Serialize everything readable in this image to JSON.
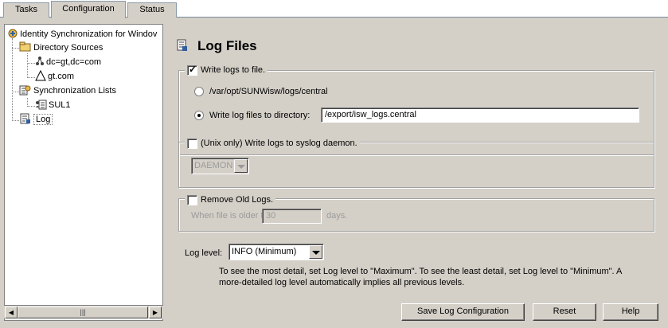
{
  "tabs": [
    {
      "label": "Tasks"
    },
    {
      "label": "Configuration"
    },
    {
      "label": "Status"
    }
  ],
  "tree": {
    "root": "Identity Synchronization for Windov",
    "directory_sources": "Directory Sources",
    "ds_child_1": "dc=gt,dc=com",
    "ds_child_2": "gt.com",
    "sync_lists": "Synchronization Lists",
    "sync_child_1": "SUL1",
    "log": "Log"
  },
  "page": {
    "title": "Log Files"
  },
  "write_to_file": {
    "checked": true,
    "label": "Write logs to file.",
    "option_default": "/var/opt/SUNWisw/logs/central",
    "option_custom_label": "Write log files to directory:",
    "directory_value": "/export/isw_logs.central"
  },
  "syslog": {
    "checked": false,
    "label": "(Unix only) Write logs to syslog daemon.",
    "facility_value": "DAEMON"
  },
  "remove_old": {
    "checked": false,
    "label": "Remove Old Logs.",
    "older_than_label": "When file is older than :",
    "days_value": "30",
    "days_unit": "days."
  },
  "log_level": {
    "label": "Log level:",
    "value": "INFO (Minimum)",
    "help_line_1": "To see the most detail, set Log level to \"Maximum\". To see the least detail, set Log level to \"Minimum\". A",
    "help_line_2": "more-detailed log level automatically implies all previous levels."
  },
  "buttons": {
    "save": "Save Log Configuration",
    "reset": "Reset",
    "help": "Help"
  },
  "scrollbar": {
    "thumb_glyph": "|||"
  }
}
